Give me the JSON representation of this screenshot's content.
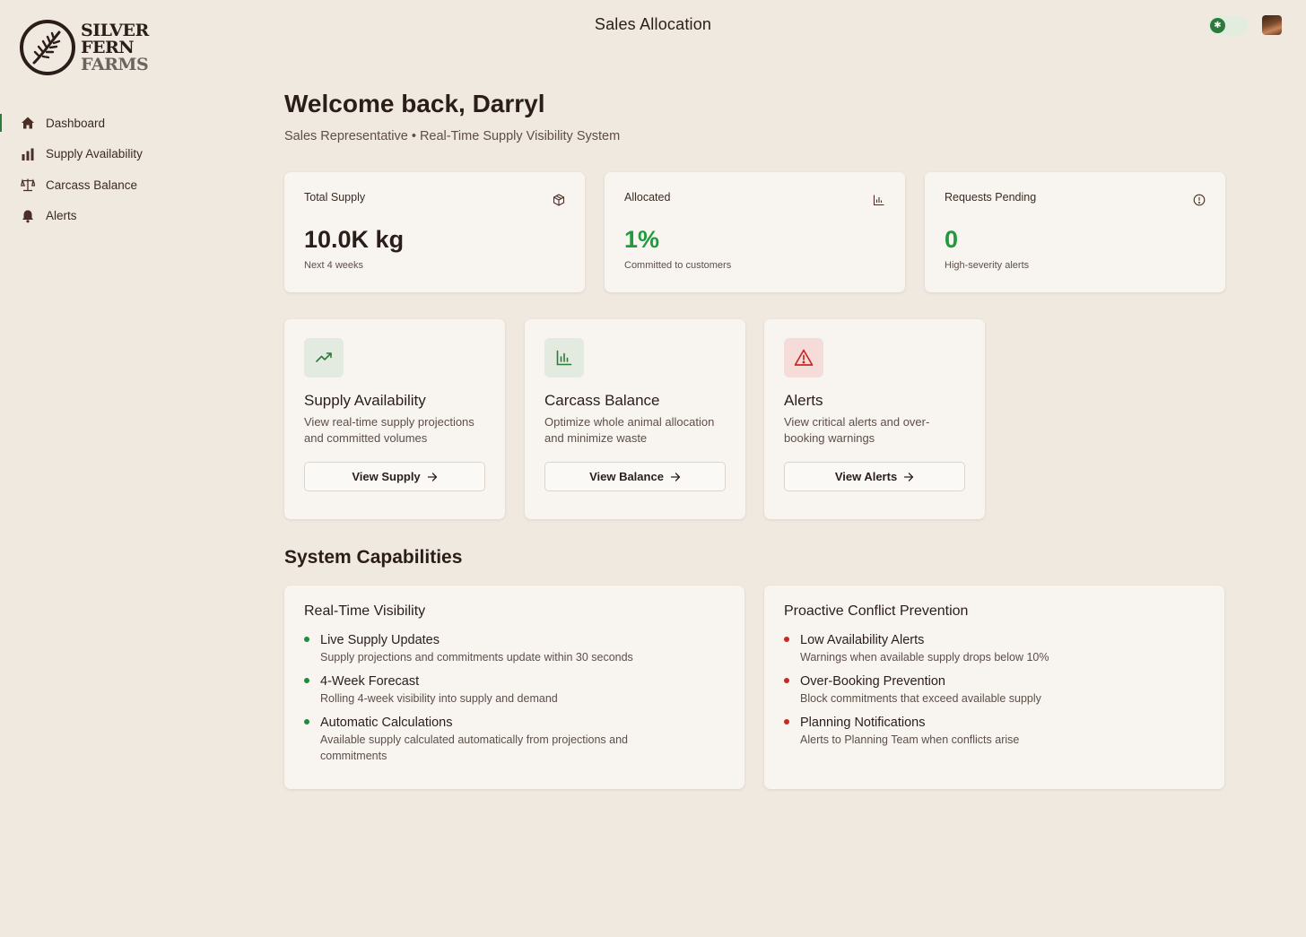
{
  "brand": {
    "line1": "SILVER",
    "line2": "FERN",
    "line3": "FARMS"
  },
  "header": {
    "title": "Sales Allocation"
  },
  "sidebar": {
    "items": [
      {
        "label": "Dashboard",
        "icon": "home-icon",
        "active": true
      },
      {
        "label": "Supply Availability",
        "icon": "bar-chart-icon",
        "active": false
      },
      {
        "label": "Carcass Balance",
        "icon": "scale-icon",
        "active": false
      },
      {
        "label": "Alerts",
        "icon": "bell-icon",
        "active": false
      }
    ]
  },
  "welcome": {
    "title": "Welcome back, Darryl",
    "subtitle": "Sales Representative • Real-Time Supply Visibility System"
  },
  "stats": [
    {
      "label": "Total Supply",
      "value": "10.0K kg",
      "note": "Next 4 weeks",
      "icon": "package-icon"
    },
    {
      "label": "Allocated",
      "value": "1%",
      "note": "Committed to customers",
      "icon": "bar-chart-icon"
    },
    {
      "label": "Requests Pending",
      "value": "0",
      "note": "High-severity alerts",
      "icon": "info-circle-icon"
    }
  ],
  "cards": [
    {
      "title": "Supply Availability",
      "desc": "View real-time supply projections and committed volumes",
      "button": "View Supply",
      "icon": "trending-up-icon"
    },
    {
      "title": "Carcass Balance",
      "desc": "Optimize whole animal allocation and minimize waste",
      "button": "View Balance",
      "icon": "bar-chart-icon"
    },
    {
      "title": "Alerts",
      "desc": "View critical alerts and over-booking warnings",
      "button": "View Alerts",
      "icon": "warning-triangle-icon"
    }
  ],
  "capabilities": {
    "section_title": "System Capabilities",
    "groups": [
      {
        "title": "Real-Time Visibility",
        "items": [
          {
            "title": "Live Supply Updates",
            "desc": "Supply projections and commitments update within 30 seconds"
          },
          {
            "title": "4-Week Forecast",
            "desc": "Rolling 4-week visibility into supply and demand"
          },
          {
            "title": "Automatic Calculations",
            "desc": "Available supply calculated automatically from projections and commitments"
          }
        ]
      },
      {
        "title": "Proactive Conflict Prevention",
        "items": [
          {
            "title": "Low Availability Alerts",
            "desc": "Warnings when available supply drops below 10%"
          },
          {
            "title": "Over-Booking Prevention",
            "desc": "Block commitments that exceed available supply"
          },
          {
            "title": "Planning Notifications",
            "desc": "Alerts to Planning Team when conflicts arise"
          }
        ]
      }
    ]
  },
  "colors": {
    "background": "#f0e9e0",
    "card": "#f8f5f0",
    "accent_green": "#1f9a3c",
    "alert_red": "#c62828",
    "text_dark": "#2b1d19"
  }
}
